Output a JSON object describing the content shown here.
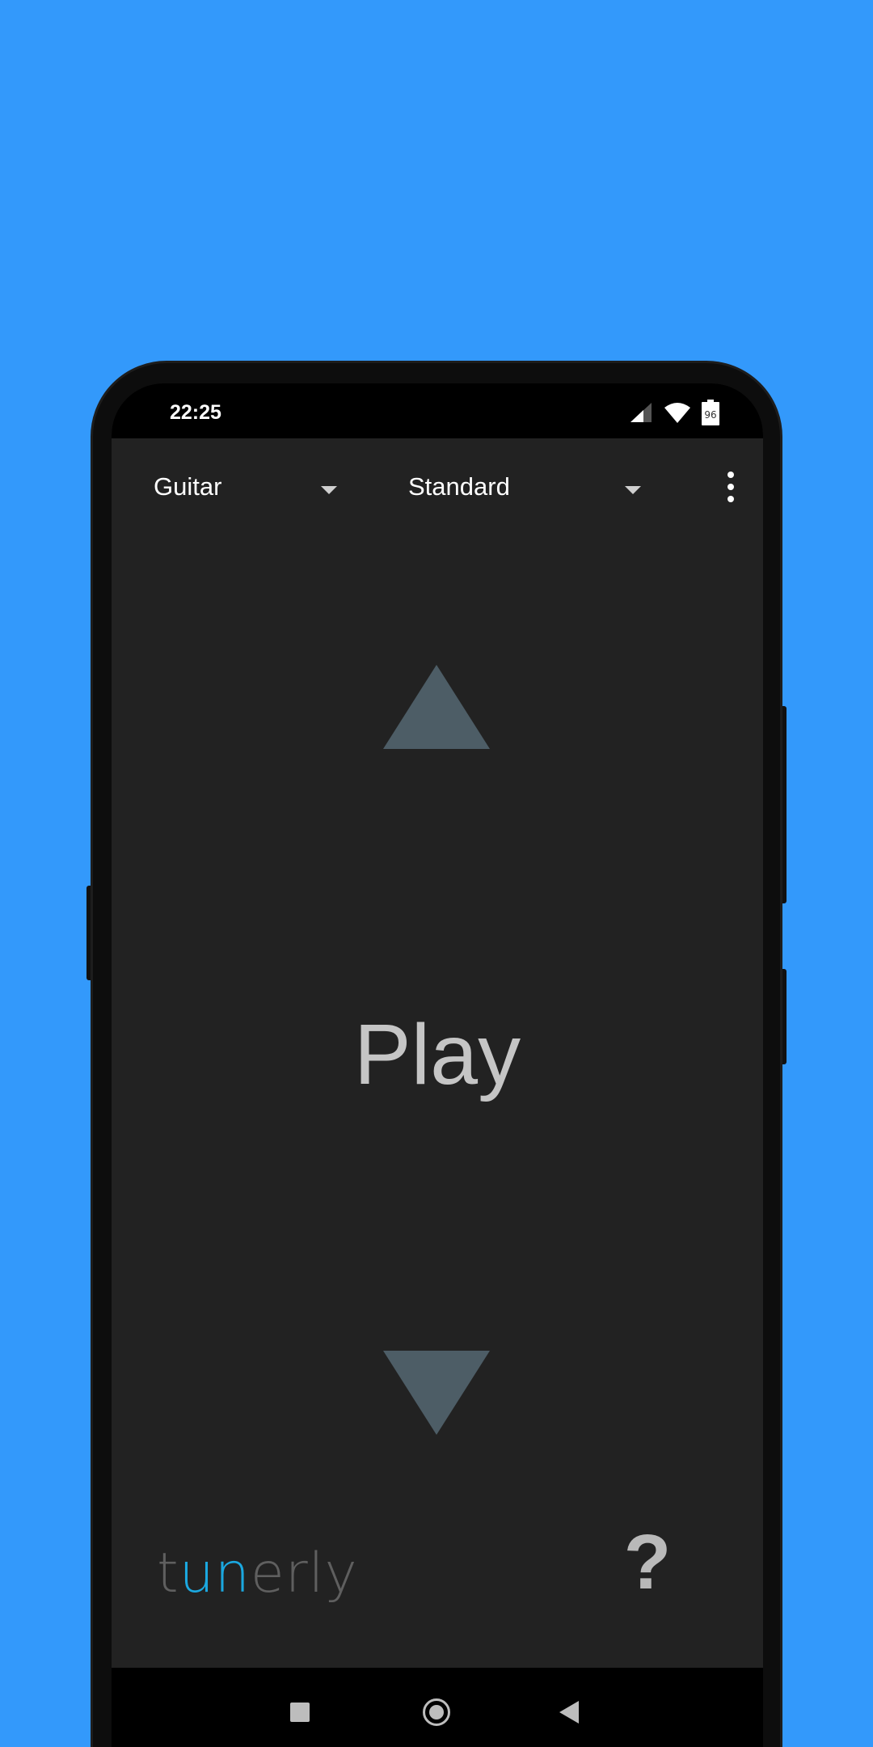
{
  "status_bar": {
    "time": "22:25",
    "battery_level": "96",
    "icons": [
      "cellular-signal-icon",
      "wifi-icon",
      "battery-icon"
    ]
  },
  "toolbar": {
    "instrument": "Guitar",
    "tuning": "Standard",
    "menu_icon": "more-vert-icon"
  },
  "tuner": {
    "prompt": "Play",
    "up_icon": "arrow-up-icon",
    "down_icon": "arrow-down-icon"
  },
  "footer": {
    "logo_parts": [
      "t",
      "un",
      "erly"
    ],
    "help_label": "?"
  },
  "colors": {
    "background": "#3399fb",
    "screen": "#222222",
    "arrow": "#4d5d66",
    "logo_accent": "#1ba8e0",
    "logo_gray": "#5f5f5f"
  },
  "nav_bar": {
    "icons": [
      "recent-apps-icon",
      "home-icon",
      "back-icon"
    ]
  }
}
